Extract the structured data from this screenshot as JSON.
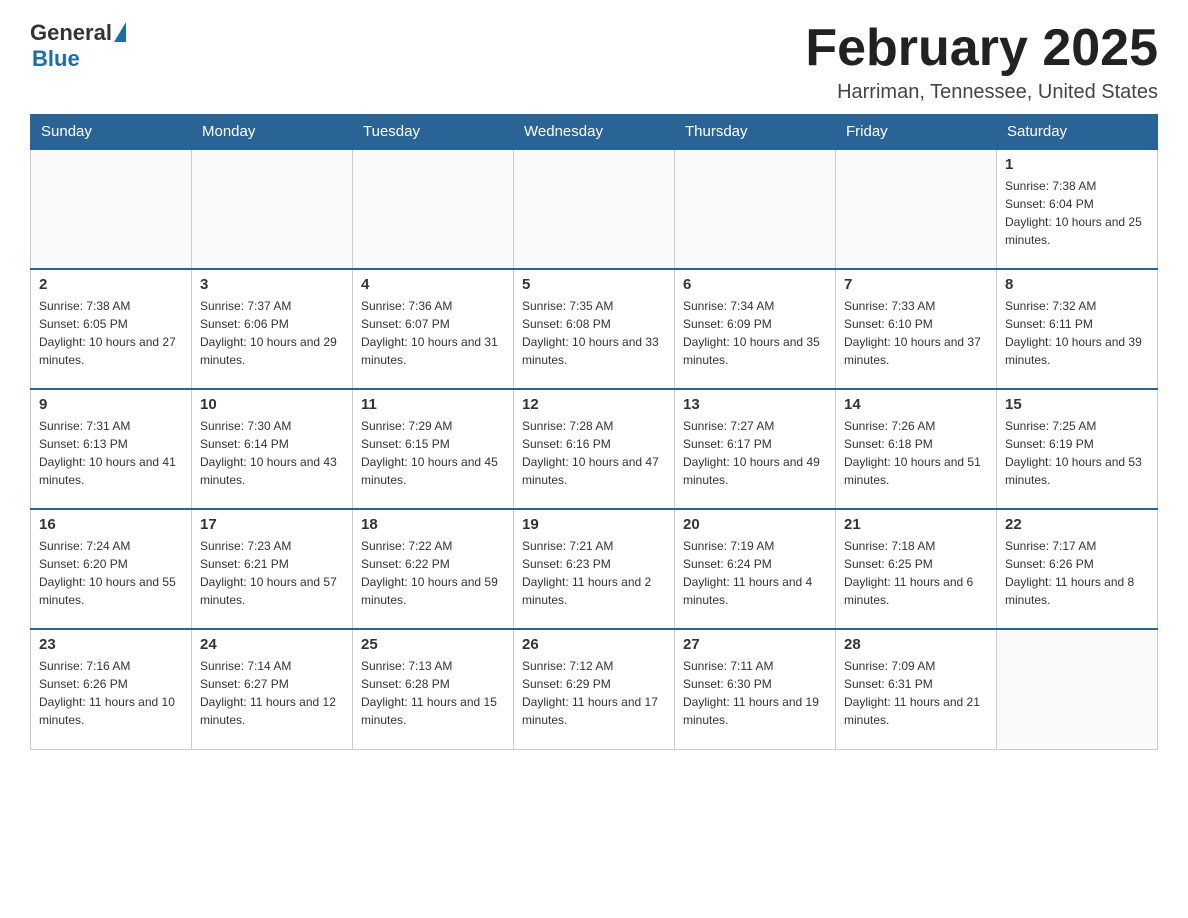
{
  "logo": {
    "general": "General",
    "blue": "Blue"
  },
  "header": {
    "month_title": "February 2025",
    "location": "Harriman, Tennessee, United States"
  },
  "days_of_week": [
    "Sunday",
    "Monday",
    "Tuesday",
    "Wednesday",
    "Thursday",
    "Friday",
    "Saturday"
  ],
  "weeks": [
    [
      {
        "date": "",
        "sunrise": "",
        "sunset": "",
        "daylight": ""
      },
      {
        "date": "",
        "sunrise": "",
        "sunset": "",
        "daylight": ""
      },
      {
        "date": "",
        "sunrise": "",
        "sunset": "",
        "daylight": ""
      },
      {
        "date": "",
        "sunrise": "",
        "sunset": "",
        "daylight": ""
      },
      {
        "date": "",
        "sunrise": "",
        "sunset": "",
        "daylight": ""
      },
      {
        "date": "",
        "sunrise": "",
        "sunset": "",
        "daylight": ""
      },
      {
        "date": "1",
        "sunrise": "Sunrise: 7:38 AM",
        "sunset": "Sunset: 6:04 PM",
        "daylight": "Daylight: 10 hours and 25 minutes."
      }
    ],
    [
      {
        "date": "2",
        "sunrise": "Sunrise: 7:38 AM",
        "sunset": "Sunset: 6:05 PM",
        "daylight": "Daylight: 10 hours and 27 minutes."
      },
      {
        "date": "3",
        "sunrise": "Sunrise: 7:37 AM",
        "sunset": "Sunset: 6:06 PM",
        "daylight": "Daylight: 10 hours and 29 minutes."
      },
      {
        "date": "4",
        "sunrise": "Sunrise: 7:36 AM",
        "sunset": "Sunset: 6:07 PM",
        "daylight": "Daylight: 10 hours and 31 minutes."
      },
      {
        "date": "5",
        "sunrise": "Sunrise: 7:35 AM",
        "sunset": "Sunset: 6:08 PM",
        "daylight": "Daylight: 10 hours and 33 minutes."
      },
      {
        "date": "6",
        "sunrise": "Sunrise: 7:34 AM",
        "sunset": "Sunset: 6:09 PM",
        "daylight": "Daylight: 10 hours and 35 minutes."
      },
      {
        "date": "7",
        "sunrise": "Sunrise: 7:33 AM",
        "sunset": "Sunset: 6:10 PM",
        "daylight": "Daylight: 10 hours and 37 minutes."
      },
      {
        "date": "8",
        "sunrise": "Sunrise: 7:32 AM",
        "sunset": "Sunset: 6:11 PM",
        "daylight": "Daylight: 10 hours and 39 minutes."
      }
    ],
    [
      {
        "date": "9",
        "sunrise": "Sunrise: 7:31 AM",
        "sunset": "Sunset: 6:13 PM",
        "daylight": "Daylight: 10 hours and 41 minutes."
      },
      {
        "date": "10",
        "sunrise": "Sunrise: 7:30 AM",
        "sunset": "Sunset: 6:14 PM",
        "daylight": "Daylight: 10 hours and 43 minutes."
      },
      {
        "date": "11",
        "sunrise": "Sunrise: 7:29 AM",
        "sunset": "Sunset: 6:15 PM",
        "daylight": "Daylight: 10 hours and 45 minutes."
      },
      {
        "date": "12",
        "sunrise": "Sunrise: 7:28 AM",
        "sunset": "Sunset: 6:16 PM",
        "daylight": "Daylight: 10 hours and 47 minutes."
      },
      {
        "date": "13",
        "sunrise": "Sunrise: 7:27 AM",
        "sunset": "Sunset: 6:17 PM",
        "daylight": "Daylight: 10 hours and 49 minutes."
      },
      {
        "date": "14",
        "sunrise": "Sunrise: 7:26 AM",
        "sunset": "Sunset: 6:18 PM",
        "daylight": "Daylight: 10 hours and 51 minutes."
      },
      {
        "date": "15",
        "sunrise": "Sunrise: 7:25 AM",
        "sunset": "Sunset: 6:19 PM",
        "daylight": "Daylight: 10 hours and 53 minutes."
      }
    ],
    [
      {
        "date": "16",
        "sunrise": "Sunrise: 7:24 AM",
        "sunset": "Sunset: 6:20 PM",
        "daylight": "Daylight: 10 hours and 55 minutes."
      },
      {
        "date": "17",
        "sunrise": "Sunrise: 7:23 AM",
        "sunset": "Sunset: 6:21 PM",
        "daylight": "Daylight: 10 hours and 57 minutes."
      },
      {
        "date": "18",
        "sunrise": "Sunrise: 7:22 AM",
        "sunset": "Sunset: 6:22 PM",
        "daylight": "Daylight: 10 hours and 59 minutes."
      },
      {
        "date": "19",
        "sunrise": "Sunrise: 7:21 AM",
        "sunset": "Sunset: 6:23 PM",
        "daylight": "Daylight: 11 hours and 2 minutes."
      },
      {
        "date": "20",
        "sunrise": "Sunrise: 7:19 AM",
        "sunset": "Sunset: 6:24 PM",
        "daylight": "Daylight: 11 hours and 4 minutes."
      },
      {
        "date": "21",
        "sunrise": "Sunrise: 7:18 AM",
        "sunset": "Sunset: 6:25 PM",
        "daylight": "Daylight: 11 hours and 6 minutes."
      },
      {
        "date": "22",
        "sunrise": "Sunrise: 7:17 AM",
        "sunset": "Sunset: 6:26 PM",
        "daylight": "Daylight: 11 hours and 8 minutes."
      }
    ],
    [
      {
        "date": "23",
        "sunrise": "Sunrise: 7:16 AM",
        "sunset": "Sunset: 6:26 PM",
        "daylight": "Daylight: 11 hours and 10 minutes."
      },
      {
        "date": "24",
        "sunrise": "Sunrise: 7:14 AM",
        "sunset": "Sunset: 6:27 PM",
        "daylight": "Daylight: 11 hours and 12 minutes."
      },
      {
        "date": "25",
        "sunrise": "Sunrise: 7:13 AM",
        "sunset": "Sunset: 6:28 PM",
        "daylight": "Daylight: 11 hours and 15 minutes."
      },
      {
        "date": "26",
        "sunrise": "Sunrise: 7:12 AM",
        "sunset": "Sunset: 6:29 PM",
        "daylight": "Daylight: 11 hours and 17 minutes."
      },
      {
        "date": "27",
        "sunrise": "Sunrise: 7:11 AM",
        "sunset": "Sunset: 6:30 PM",
        "daylight": "Daylight: 11 hours and 19 minutes."
      },
      {
        "date": "28",
        "sunrise": "Sunrise: 7:09 AM",
        "sunset": "Sunset: 6:31 PM",
        "daylight": "Daylight: 11 hours and 21 minutes."
      },
      {
        "date": "",
        "sunrise": "",
        "sunset": "",
        "daylight": ""
      }
    ]
  ]
}
